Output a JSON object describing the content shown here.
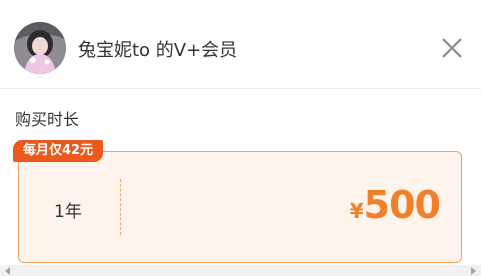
{
  "header": {
    "title": "兔宝妮to 的V+会员",
    "avatar_icon": "user-avatar",
    "close_icon": "close-icon"
  },
  "section": {
    "label": "购买时长"
  },
  "plan": {
    "badge": "每月仅42元",
    "duration": "1年",
    "currency": "¥",
    "price": "500"
  },
  "colors": {
    "accent": "#f0812a",
    "badge": "#ea5a1c",
    "card_bg": "#fff4ec",
    "card_border": "#f7a35a"
  }
}
